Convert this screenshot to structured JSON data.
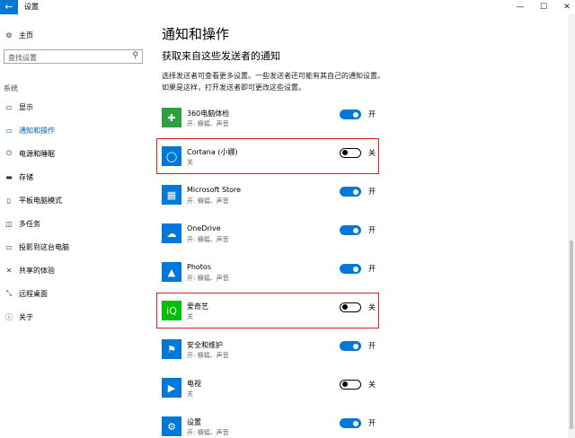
{
  "window": {
    "back_glyph": "←",
    "title": "设置",
    "minimize_glyph": "—",
    "maximize_glyph": "☐",
    "close_glyph": "✕"
  },
  "sidebar": {
    "home": {
      "icon": "gear-icon",
      "glyph": "⚙",
      "label": "主页"
    },
    "search": {
      "placeholder": "查找设置",
      "icon": "search-icon",
      "glyph": "⚲"
    },
    "section": "系统",
    "items": [
      {
        "key": "display",
        "icon": "monitor-icon",
        "glyph": "▭",
        "label": "显示",
        "active": false
      },
      {
        "key": "notifications",
        "icon": "notification-icon",
        "glyph": "▭",
        "label": "通知和操作",
        "active": true
      },
      {
        "key": "power",
        "icon": "power-icon",
        "glyph": "⏻",
        "label": "电源和睡眠",
        "active": false
      },
      {
        "key": "storage",
        "icon": "storage-icon",
        "glyph": "▬",
        "label": "存储",
        "active": false
      },
      {
        "key": "tablet",
        "icon": "tablet-icon",
        "glyph": "▯",
        "label": "平板电脑模式",
        "active": false
      },
      {
        "key": "multitask",
        "icon": "multitask-icon",
        "glyph": "◫",
        "label": "多任务",
        "active": false
      },
      {
        "key": "project",
        "icon": "project-icon",
        "glyph": "▭",
        "label": "投影到这台电脑",
        "active": false
      },
      {
        "key": "shared",
        "icon": "share-icon",
        "glyph": "✕",
        "label": "共享的体验",
        "active": false
      },
      {
        "key": "remote",
        "icon": "remote-desktop-icon",
        "glyph": "⤡",
        "label": "远程桌面",
        "active": false
      },
      {
        "key": "about",
        "icon": "info-icon",
        "glyph": "ⓘ",
        "label": "关于",
        "active": false
      }
    ]
  },
  "main": {
    "title": "通知和操作",
    "section_title": "获取来自这些发送者的通知",
    "description": "选择发送者可查看更多设置。一些发送者还可能有其自己的通知设置。如果是这样，打开发送者即可更改这些设置。",
    "apps": [
      {
        "name": "360电脑体检",
        "sub": "开: 横幅、声音",
        "on": true,
        "state": "开",
        "icon": "360-icon",
        "glyph": "✚",
        "color": "#2e9e3e",
        "highlight": false
      },
      {
        "name": "Cortana (小娜)",
        "sub": "关",
        "on": false,
        "state": "关",
        "icon": "cortana-icon",
        "glyph": "◯",
        "color": "#0078d7",
        "highlight": true
      },
      {
        "name": "Microsoft Store",
        "sub": "开: 横幅、声音",
        "on": true,
        "state": "开",
        "icon": "store-icon",
        "glyph": "▦",
        "color": "#0078d7",
        "highlight": false
      },
      {
        "name": "OneDrive",
        "sub": "开: 横幅、声音",
        "on": true,
        "state": "开",
        "icon": "onedrive-icon",
        "glyph": "☁",
        "color": "#0078d7",
        "highlight": false
      },
      {
        "name": "Photos",
        "sub": "开: 横幅、声音",
        "on": true,
        "state": "开",
        "icon": "photos-icon",
        "glyph": "▲",
        "color": "#0078d7",
        "highlight": false
      },
      {
        "name": "爱奇艺",
        "sub": "关",
        "on": false,
        "state": "关",
        "icon": "iqiyi-icon",
        "glyph": "iQ",
        "color": "#00be06",
        "highlight": true
      },
      {
        "name": "安全和维护",
        "sub": "开: 横幅、声音",
        "on": true,
        "state": "开",
        "icon": "flag-icon",
        "glyph": "⚑",
        "color": "#0078d7",
        "highlight": false
      },
      {
        "name": "电视",
        "sub": "关",
        "on": false,
        "state": "关",
        "icon": "tv-icon",
        "glyph": "▶",
        "color": "#0078d7",
        "highlight": false
      },
      {
        "name": "设置",
        "sub": "开: 横幅、声音",
        "on": true,
        "state": "开",
        "icon": "settings-icon",
        "glyph": "⚙",
        "color": "#0078d7",
        "highlight": false
      }
    ]
  }
}
